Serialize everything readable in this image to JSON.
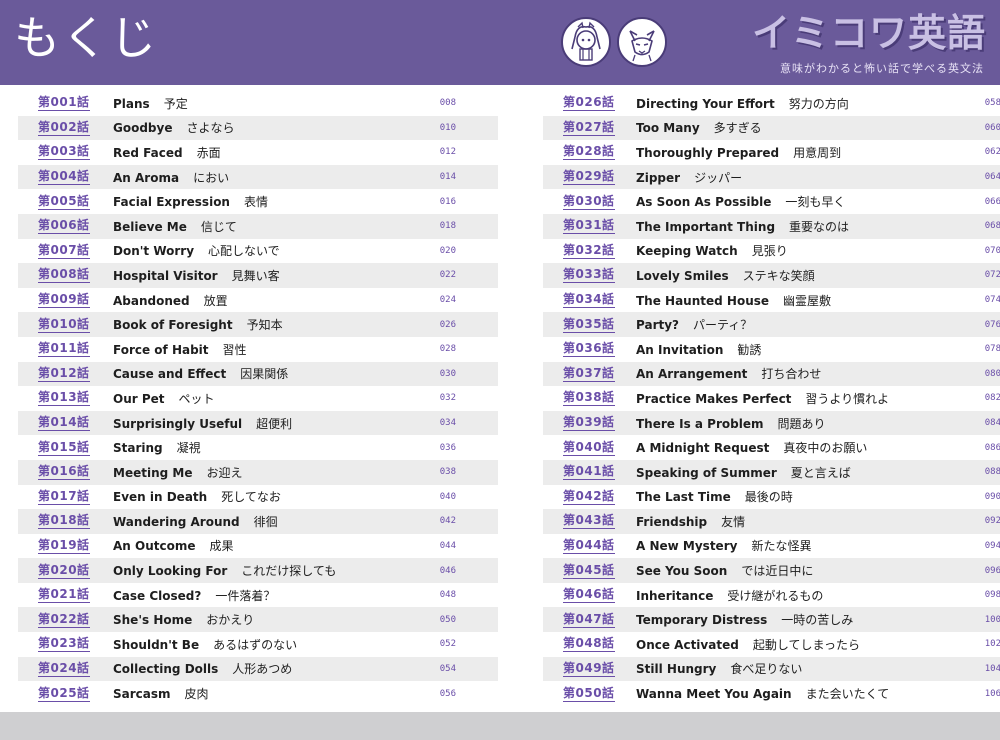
{
  "header": {
    "title": "もくじ",
    "logo": "イミコワ英語",
    "subtitle": "意味がわかると怖い話で学べる英文法",
    "accent_color": "#6a5a9a",
    "ep_color": "#6a4ea8"
  },
  "mascots": [
    "girl-mascot-icon",
    "fox-mascot-icon"
  ],
  "left_entries": [
    {
      "ep": "第001話",
      "en": "Plans",
      "ja": "予定",
      "page": "008"
    },
    {
      "ep": "第002話",
      "en": "Goodbye",
      "ja": "さよなら",
      "page": "010"
    },
    {
      "ep": "第003話",
      "en": "Red Faced",
      "ja": "赤面",
      "page": "012"
    },
    {
      "ep": "第004話",
      "en": "An Aroma",
      "ja": "におい",
      "page": "014"
    },
    {
      "ep": "第005話",
      "en": "Facial Expression",
      "ja": "表情",
      "page": "016"
    },
    {
      "ep": "第006話",
      "en": "Believe Me",
      "ja": "信じて",
      "page": "018"
    },
    {
      "ep": "第007話",
      "en": "Don't Worry",
      "ja": "心配しないで",
      "page": "020"
    },
    {
      "ep": "第008話",
      "en": "Hospital Visitor",
      "ja": "見舞い客",
      "page": "022"
    },
    {
      "ep": "第009話",
      "en": "Abandoned",
      "ja": "放置",
      "page": "024"
    },
    {
      "ep": "第010話",
      "en": "Book of Foresight",
      "ja": "予知本",
      "page": "026"
    },
    {
      "ep": "第011話",
      "en": "Force of Habit",
      "ja": "習性",
      "page": "028"
    },
    {
      "ep": "第012話",
      "en": "Cause and Effect",
      "ja": "因果関係",
      "page": "030"
    },
    {
      "ep": "第013話",
      "en": "Our Pet",
      "ja": "ペット",
      "page": "032"
    },
    {
      "ep": "第014話",
      "en": "Surprisingly Useful",
      "ja": "超便利",
      "page": "034"
    },
    {
      "ep": "第015話",
      "en": "Staring",
      "ja": "凝視",
      "page": "036"
    },
    {
      "ep": "第016話",
      "en": "Meeting Me",
      "ja": "お迎え",
      "page": "038"
    },
    {
      "ep": "第017話",
      "en": "Even in Death",
      "ja": "死してなお",
      "page": "040"
    },
    {
      "ep": "第018話",
      "en": "Wandering Around",
      "ja": "徘徊",
      "page": "042"
    },
    {
      "ep": "第019話",
      "en": "An Outcome",
      "ja": "成果",
      "page": "044"
    },
    {
      "ep": "第020話",
      "en": "Only Looking For",
      "ja": "これだけ探しても",
      "page": "046"
    },
    {
      "ep": "第021話",
      "en": "Case Closed?",
      "ja": "一件落着？",
      "page": "048"
    },
    {
      "ep": "第022話",
      "en": "She's Home",
      "ja": "おかえり",
      "page": "050"
    },
    {
      "ep": "第023話",
      "en": "Shouldn't Be",
      "ja": "あるはずのない",
      "page": "052"
    },
    {
      "ep": "第024話",
      "en": "Collecting Dolls",
      "ja": "人形あつめ",
      "page": "054"
    },
    {
      "ep": "第025話",
      "en": "Sarcasm",
      "ja": "皮肉",
      "page": "056"
    }
  ],
  "right_entries": [
    {
      "ep": "第026話",
      "en": "Directing Your Effort",
      "ja": "努力の方向",
      "page": "058"
    },
    {
      "ep": "第027話",
      "en": "Too Many",
      "ja": "多すぎる",
      "page": "060"
    },
    {
      "ep": "第028話",
      "en": "Thoroughly Prepared",
      "ja": "用意周到",
      "page": "062"
    },
    {
      "ep": "第029話",
      "en": "Zipper",
      "ja": "ジッパー",
      "page": "064"
    },
    {
      "ep": "第030話",
      "en": "As Soon As Possible",
      "ja": "一刻も早く",
      "page": "066"
    },
    {
      "ep": "第031話",
      "en": "The Important Thing",
      "ja": "重要なのは",
      "page": "068"
    },
    {
      "ep": "第032話",
      "en": "Keeping Watch",
      "ja": "見張り",
      "page": "070"
    },
    {
      "ep": "第033話",
      "en": "Lovely Smiles",
      "ja": "ステキな笑顔",
      "page": "072"
    },
    {
      "ep": "第034話",
      "en": "The Haunted House",
      "ja": "幽霊屋敷",
      "page": "074"
    },
    {
      "ep": "第035話",
      "en": "Party?",
      "ja": "パーティ？",
      "page": "076"
    },
    {
      "ep": "第036話",
      "en": "An Invitation",
      "ja": "勧誘",
      "page": "078"
    },
    {
      "ep": "第037話",
      "en": "An Arrangement",
      "ja": "打ち合わせ",
      "page": "080"
    },
    {
      "ep": "第038話",
      "en": "Practice Makes Perfect",
      "ja": "習うより慣れよ",
      "page": "082"
    },
    {
      "ep": "第039話",
      "en": "There Is a Problem",
      "ja": "問題あり",
      "page": "084"
    },
    {
      "ep": "第040話",
      "en": "A Midnight Request",
      "ja": "真夜中のお願い",
      "page": "086"
    },
    {
      "ep": "第041話",
      "en": "Speaking of Summer",
      "ja": "夏と言えば",
      "page": "088"
    },
    {
      "ep": "第042話",
      "en": "The Last Time",
      "ja": "最後の時",
      "page": "090"
    },
    {
      "ep": "第043話",
      "en": "Friendship",
      "ja": "友情",
      "page": "092"
    },
    {
      "ep": "第044話",
      "en": "A New Mystery",
      "ja": "新たな怪異",
      "page": "094"
    },
    {
      "ep": "第045話",
      "en": "See You Soon",
      "ja": "では近日中に",
      "page": "096"
    },
    {
      "ep": "第046話",
      "en": "Inheritance",
      "ja": "受け継がれるもの",
      "page": "098"
    },
    {
      "ep": "第047話",
      "en": "Temporary Distress",
      "ja": "一時の苦しみ",
      "page": "100"
    },
    {
      "ep": "第048話",
      "en": "Once Activated",
      "ja": "起動してしまったら",
      "page": "102"
    },
    {
      "ep": "第049話",
      "en": "Still Hungry",
      "ja": "食べ足りない",
      "page": "104"
    },
    {
      "ep": "第050話",
      "en": "Wanna Meet You Again",
      "ja": "また会いたくて",
      "page": "106"
    }
  ]
}
